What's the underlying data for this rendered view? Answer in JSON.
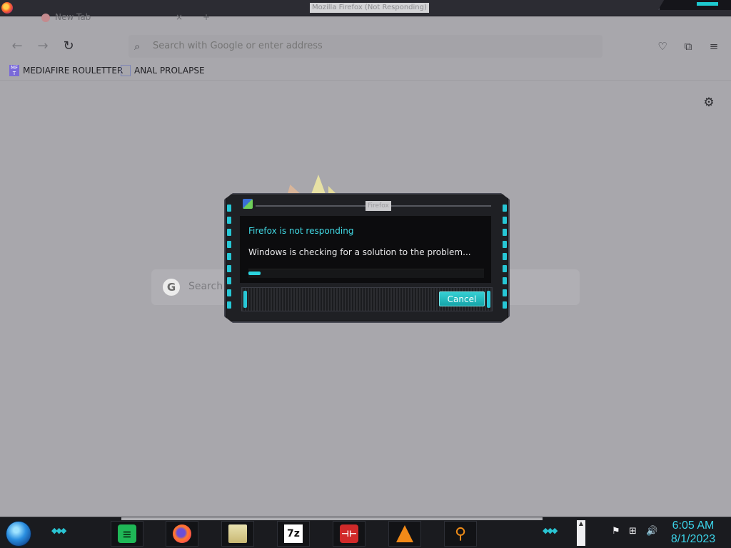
{
  "window": {
    "title": "Mozilla Firefox (Not Responding)"
  },
  "tabs": [
    {
      "label": "New Tab",
      "close": "×"
    }
  ],
  "tab_new": "+",
  "navbar": {
    "back_icon": "←",
    "forward_icon": "→",
    "reload_icon": "↻",
    "search_glyph": "⌕",
    "url_placeholder": "Search with Google or enter address",
    "pocket_icon": "♡",
    "extensions_icon": "⧉",
    "menu_icon": "≡"
  },
  "bookmarks": [
    {
      "label": "MEDIAFIRE ROULETTER",
      "icon_text": "MF T"
    },
    {
      "label": "ANAL PROLAPSE",
      "icon_text": ""
    }
  ],
  "content": {
    "settings_icon": "⚙",
    "google_logo": "G",
    "search_placeholder": "Search"
  },
  "dialog": {
    "title": "Firefox",
    "heading": "Firefox is not responding",
    "message": "Windows is checking for a solution to the problem...",
    "progress": 0.05,
    "cancel_label": "Cancel"
  },
  "taskbar": {
    "chevrons": "◆◆◆",
    "apps": [
      {
        "name": "notes",
        "glyph": "≡"
      },
      {
        "name": "firefox",
        "glyph": ""
      },
      {
        "name": "files",
        "glyph": ""
      },
      {
        "name": "7zip",
        "glyph": "7z"
      },
      {
        "name": "red-app",
        "glyph": "⊣⊢"
      },
      {
        "name": "vlc",
        "glyph": ""
      },
      {
        "name": "search",
        "glyph": "⚲"
      }
    ],
    "tray": {
      "show_hidden": "▲",
      "flag_icon": "⚑",
      "network_icon": "⊞",
      "volume_icon": "🔊"
    },
    "clock_time": "6:05 AM",
    "clock_date": "8/1/2023"
  },
  "colors": {
    "accent": "#2bd4e0",
    "dialog_heading": "#41d9e4",
    "clock": "#3bd3e8"
  }
}
